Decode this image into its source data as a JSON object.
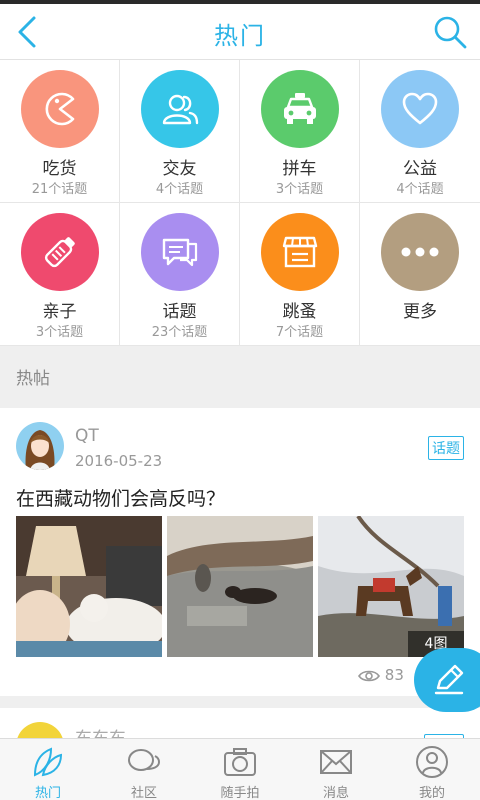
{
  "header": {
    "title": "热门"
  },
  "categories": [
    {
      "name": "吃货",
      "count": "21个话题",
      "color": "#f9957d",
      "icon": "pacman-icon"
    },
    {
      "name": "交友",
      "count": "4个话题",
      "color": "#36c6e8",
      "icon": "people-icon"
    },
    {
      "name": "拼车",
      "count": "3个话题",
      "color": "#5bcb6c",
      "icon": "taxi-icon"
    },
    {
      "name": "公益",
      "count": "4个话题",
      "color": "#8cc8f5",
      "icon": "heart-icon"
    },
    {
      "name": "亲子",
      "count": "3个话题",
      "color": "#ef4a6e",
      "icon": "baby-bottle-icon"
    },
    {
      "name": "话题",
      "count": "23个话题",
      "color": "#a98ef0",
      "icon": "chat-bubbles-icon"
    },
    {
      "name": "跳蚤",
      "count": "7个话题",
      "color": "#fb8e1b",
      "icon": "store-icon"
    },
    {
      "name": "更多",
      "count": "",
      "color": "#b39e80",
      "icon": "more-dots-icon"
    }
  ],
  "section": {
    "label": "热帖"
  },
  "post": {
    "user": "QT",
    "date": "2016-05-23",
    "tag": "话题",
    "title": "在西藏动物们会高反吗？",
    "image_count": "4图",
    "views": "83"
  },
  "post2": {
    "user": "东东东"
  },
  "tabs": [
    {
      "label": "热门",
      "icon": "leaf-icon",
      "active": true
    },
    {
      "label": "社区",
      "icon": "chat-icon",
      "active": false
    },
    {
      "label": "随手拍",
      "icon": "camera-icon",
      "active": false
    },
    {
      "label": "消息",
      "icon": "mail-icon",
      "active": false
    },
    {
      "label": "我的",
      "icon": "user-icon",
      "active": false
    }
  ],
  "colors": {
    "accent": "#2bb3e6"
  }
}
